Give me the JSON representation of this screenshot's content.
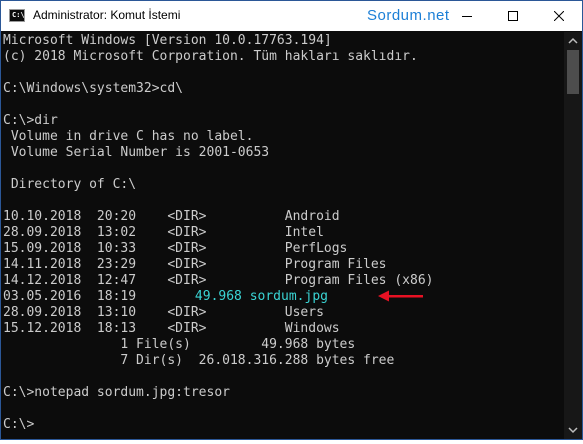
{
  "window": {
    "title": "Administrator: Komut İstemi",
    "icon_text": "C:\\.",
    "watermark": "Sordum.net"
  },
  "console": {
    "lines": [
      "Microsoft Windows [Version 10.0.17763.194]",
      "(c) 2018 Microsoft Corporation. Tüm hakları saklıdır.",
      "",
      "C:\\Windows\\system32>cd\\",
      "",
      "C:\\>dir",
      " Volume in drive C has no label.",
      " Volume Serial Number is 2001-0653",
      "",
      " Directory of C:\\",
      "",
      "10.10.2018  20:20    <DIR>          Android",
      "28.09.2018  13:02    <DIR>          Intel",
      "15.09.2018  10:33    <DIR>          PerfLogs",
      "14.11.2018  23:29    <DIR>          Program Files",
      "14.12.2018  12:47    <DIR>          Program Files (x86)",
      "03.05.2016  18:19",
      "28.09.2018  13:10    <DIR>          Users",
      "15.12.2018  18:13    <DIR>          Windows",
      "               1 File(s)         49.968 bytes",
      "               7 Dir(s)  26.018.316.288 bytes free",
      "",
      "C:\\>notepad sordum.jpg:tresor",
      "",
      "C:\\>"
    ],
    "highlight_entry": "            49.968 sordum.jpg",
    "highlight_color": "#3ad5d5",
    "arrow_color": "#e81123"
  },
  "colors": {
    "console_bg": "#0c0c0c",
    "console_fg": "#cccccc",
    "accent": "#1c7fd6"
  }
}
